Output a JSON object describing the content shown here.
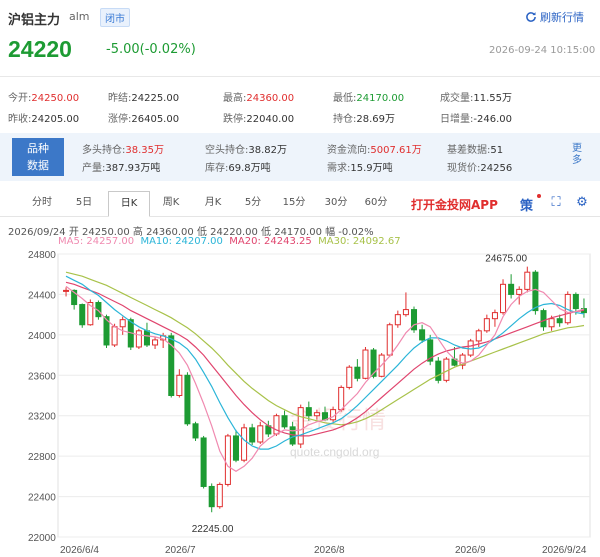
{
  "header": {
    "title": "沪铝主力",
    "code": "alm",
    "status": "闭市",
    "refresh_label": "刷新行情"
  },
  "quote": {
    "price": "24220",
    "change": "-5.00(-0.02%)",
    "datetime": "2026-09-24 10:15:00"
  },
  "stats": [
    [
      {
        "label": "今开:",
        "value": "24250.00",
        "tone": "up"
      },
      {
        "label": "昨结:",
        "value": "24225.00",
        "tone": "neu"
      },
      {
        "label": "最高:",
        "value": "24360.00",
        "tone": "up"
      },
      {
        "label": "最低:",
        "value": "24170.00",
        "tone": "dn"
      },
      {
        "label": "成交量:",
        "value": "11.55万",
        "tone": "neu"
      }
    ],
    [
      {
        "label": "昨收:",
        "value": "24205.00",
        "tone": "neu"
      },
      {
        "label": "涨停:",
        "value": "26405.00",
        "tone": "neu"
      },
      {
        "label": "跌停:",
        "value": "22040.00",
        "tone": "neu"
      },
      {
        "label": "持仓:",
        "value": "28.69万",
        "tone": "neu"
      },
      {
        "label": "日增量:",
        "value": "-246.00",
        "tone": "neu"
      }
    ]
  ],
  "band": {
    "tag_line1": "品种",
    "tag_line2": "数据",
    "rows": [
      [
        {
          "label": "多头持仓:",
          "value": "38.35万",
          "tone": "up"
        },
        {
          "label": "空头持仓:",
          "value": "38.82万",
          "tone": "neu"
        },
        {
          "label": "资金流向:",
          "value": "5007.61万",
          "tone": "up"
        },
        {
          "label": "基差数据:",
          "value": "51",
          "tone": "neu"
        }
      ],
      [
        {
          "label": "产量:",
          "value": "387.93万吨",
          "tone": "neu"
        },
        {
          "label": "库存:",
          "value": "69.8万吨",
          "tone": "neu"
        },
        {
          "label": "需求:",
          "value": "15.9万吨",
          "tone": "neu"
        },
        {
          "label": "现货价:",
          "value": "24256",
          "tone": "neu"
        }
      ]
    ],
    "more": "更多"
  },
  "tabs": [
    "分时",
    "5日",
    "日K",
    "周K",
    "月K",
    "5分",
    "15分",
    "30分",
    "60分"
  ],
  "active_tab": "日K",
  "promo": "打开金投网APP",
  "strategy": "策",
  "info": {
    "line1": "2026/09/24 开 24250.00 高 24360.00 低 24220.00 低 24170.00 幅 -0.02%",
    "ma5": "MA5: 24257.00",
    "ma10": "MA10: 24207.00",
    "ma20": "MA20: 24243.25",
    "ma30": "MA30: 24092.67"
  },
  "chart_data": {
    "type": "candlestick",
    "ylim": [
      22000,
      24800
    ],
    "yticks": [
      "24800",
      "24400",
      "24000",
      "23600",
      "23200",
      "22800",
      "22400",
      "22000"
    ],
    "xticks": [
      "2026/6/4",
      "2026/7",
      "2026/8",
      "2026/9",
      "2026/9/24"
    ],
    "annotations": {
      "high": "24675.00",
      "low": "22245.00"
    },
    "watermark_cn": "金投行情",
    "watermark_url": "quote.cngold.org",
    "colors": {
      "up": "#e02e2e",
      "down": "#1d9b33",
      "ma5": "#f08ab0",
      "ma10": "#2bb5d8",
      "ma20": "#e0456e",
      "ma30": "#a8c24a"
    },
    "candles": [
      [
        24430,
        24470,
        24380,
        24440
      ],
      [
        24440,
        24450,
        24250,
        24300
      ],
      [
        24300,
        24310,
        24070,
        24100
      ],
      [
        24100,
        24350,
        24090,
        24320
      ],
      [
        24320,
        24340,
        24150,
        24180
      ],
      [
        24180,
        24200,
        23870,
        23900
      ],
      [
        23900,
        24110,
        23880,
        24080
      ],
      [
        24080,
        24180,
        24000,
        24150
      ],
      [
        24150,
        24170,
        23850,
        23880
      ],
      [
        23880,
        24060,
        23860,
        24040
      ],
      [
        24040,
        24120,
        23880,
        23900
      ],
      [
        23900,
        23980,
        23860,
        23950
      ],
      [
        23950,
        24020,
        23870,
        23990
      ],
      [
        23990,
        24020,
        23380,
        23400
      ],
      [
        23400,
        23660,
        23380,
        23600
      ],
      [
        23600,
        23630,
        23100,
        23120
      ],
      [
        23120,
        23140,
        22950,
        22980
      ],
      [
        22980,
        23000,
        22480,
        22500
      ],
      [
        22500,
        22530,
        22245,
        22300
      ],
      [
        22300,
        22540,
        22280,
        22520
      ],
      [
        22520,
        23020,
        22500,
        23000
      ],
      [
        23000,
        23060,
        22740,
        22760
      ],
      [
        22760,
        23120,
        22740,
        23080
      ],
      [
        23080,
        23120,
        22910,
        22940
      ],
      [
        22940,
        23140,
        22920,
        23100
      ],
      [
        23100,
        23150,
        22990,
        23020
      ],
      [
        23020,
        23220,
        23000,
        23200
      ],
      [
        23200,
        23250,
        23070,
        23090
      ],
      [
        23090,
        23140,
        22900,
        22920
      ],
      [
        22920,
        23310,
        22880,
        23280
      ],
      [
        23280,
        23340,
        23150,
        23200
      ],
      [
        23200,
        23260,
        23160,
        23230
      ],
      [
        23230,
        23290,
        23150,
        23160
      ],
      [
        23160,
        23290,
        23140,
        23260
      ],
      [
        23260,
        23500,
        23240,
        23480
      ],
      [
        23480,
        23700,
        23460,
        23680
      ],
      [
        23680,
        23760,
        23540,
        23570
      ],
      [
        23570,
        23880,
        23560,
        23850
      ],
      [
        23850,
        23870,
        23570,
        23590
      ],
      [
        23590,
        23820,
        23580,
        23800
      ],
      [
        23800,
        24120,
        23780,
        24100
      ],
      [
        24100,
        24240,
        24070,
        24200
      ],
      [
        24200,
        24420,
        24180,
        24250
      ],
      [
        24250,
        24280,
        24020,
        24050
      ],
      [
        24050,
        24100,
        23920,
        23950
      ],
      [
        23950,
        24000,
        23700,
        23740
      ],
      [
        23740,
        23780,
        23520,
        23550
      ],
      [
        23550,
        23780,
        23530,
        23760
      ],
      [
        23760,
        23880,
        23690,
        23700
      ],
      [
        23700,
        23820,
        23660,
        23800
      ],
      [
        23800,
        23960,
        23780,
        23940
      ],
      [
        23940,
        24060,
        23880,
        24040
      ],
      [
        24040,
        24200,
        24020,
        24160
      ],
      [
        24160,
        24250,
        24080,
        24220
      ],
      [
        24220,
        24550,
        24200,
        24500
      ],
      [
        24500,
        24600,
        24360,
        24400
      ],
      [
        24400,
        24480,
        24300,
        24450
      ],
      [
        24450,
        24675,
        24420,
        24620
      ],
      [
        24620,
        24640,
        24200,
        24240
      ],
      [
        24240,
        24260,
        24040,
        24080
      ],
      [
        24080,
        24190,
        24040,
        24160
      ],
      [
        24160,
        24200,
        24080,
        24120
      ],
      [
        24120,
        24430,
        24100,
        24400
      ],
      [
        24400,
        24420,
        24200,
        24260
      ],
      [
        24260,
        24360,
        24170,
        24220
      ]
    ],
    "ma5_values": [
      24480,
      24420,
      24360,
      24290,
      24240,
      24150,
      24080,
      24040,
      24020,
      24000,
      23990,
      23980,
      23960,
      23900,
      23820,
      23700,
      23520,
      23320,
      23100,
      22850,
      22700,
      22650,
      22700,
      22780,
      22900,
      22970,
      23020,
      23060,
      23050,
      23060,
      23110,
      23140,
      23160,
      23190,
      23260,
      23340,
      23420,
      23530,
      23620,
      23700,
      23790,
      23900,
      24020,
      24100,
      24120,
      24080,
      23960,
      23840,
      23760,
      23720,
      23740,
      23800,
      23900,
      24000,
      24180,
      24300,
      24380,
      24430,
      24450,
      24420,
      24340,
      24260,
      24220,
      24230,
      24257
    ],
    "ma10_values": [
      24580,
      24540,
      24500,
      24440,
      24390,
      24320,
      24250,
      24190,
      24130,
      24080,
      24040,
      24010,
      23990,
      23960,
      23920,
      23860,
      23760,
      23630,
      23490,
      23330,
      23180,
      23050,
      22960,
      22900,
      22870,
      22870,
      22900,
      22950,
      22990,
      23010,
      23040,
      23070,
      23100,
      23130,
      23170,
      23230,
      23300,
      23380,
      23460,
      23540,
      23620,
      23700,
      23790,
      23870,
      23930,
      23970,
      23970,
      23940,
      23900,
      23870,
      23860,
      23870,
      23910,
      23960,
      24020,
      24090,
      24160,
      24220,
      24270,
      24300,
      24310,
      24290,
      24250,
      24220,
      24207
    ],
    "ma20_values": [
      24520,
      24500,
      24470,
      24440,
      24410,
      24370,
      24330,
      24290,
      24240,
      24200,
      24160,
      24120,
      24080,
      24040,
      24000,
      23950,
      23880,
      23800,
      23700,
      23600,
      23500,
      23400,
      23310,
      23230,
      23160,
      23100,
      23060,
      23030,
      23010,
      23000,
      23000,
      23020,
      23040,
      23060,
      23090,
      23130,
      23180,
      23240,
      23310,
      23380,
      23450,
      23520,
      23590,
      23660,
      23720,
      23770,
      23810,
      23840,
      23860,
      23880,
      23890,
      23910,
      23930,
      23960,
      23990,
      24020,
      24050,
      24080,
      24110,
      24140,
      24170,
      24190,
      24210,
      24230,
      24243
    ],
    "ma30_values": [
      24620,
      24600,
      24580,
      24550,
      24520,
      24490,
      24450,
      24410,
      24370,
      24330,
      24290,
      24250,
      24210,
      24170,
      24120,
      24070,
      24010,
      23940,
      23870,
      23790,
      23700,
      23620,
      23540,
      23470,
      23410,
      23350,
      23300,
      23260,
      23220,
      23190,
      23170,
      23150,
      23130,
      23120,
      23110,
      23120,
      23140,
      23170,
      23210,
      23260,
      23310,
      23360,
      23410,
      23460,
      23510,
      23560,
      23600,
      23640,
      23680,
      23710,
      23740,
      23770,
      23800,
      23830,
      23860,
      23890,
      23920,
      23950,
      23980,
      24010,
      24030,
      24050,
      24070,
      24080,
      24093
    ]
  }
}
